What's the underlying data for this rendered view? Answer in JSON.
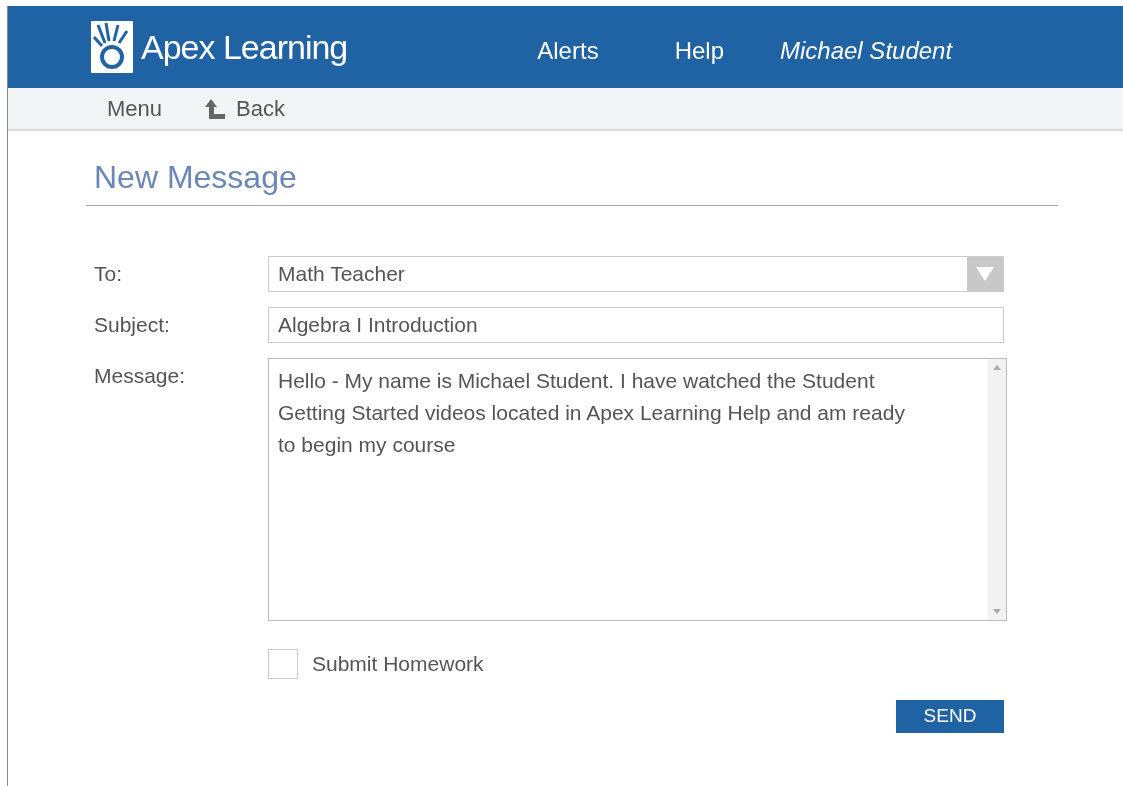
{
  "header": {
    "brand": "Apex Learning",
    "nav": [
      "Alerts",
      "Help"
    ],
    "user": "Michael Student"
  },
  "toolbar": {
    "menu": "Menu",
    "back": "Back"
  },
  "page_title": "New Message",
  "form": {
    "to": {
      "label": "To:",
      "value": "Math Teacher"
    },
    "subject": {
      "label": "Subject:",
      "value": "Algebra I Introduction"
    },
    "message": {
      "label": "Message:",
      "value": "Hello - My name is Michael Student. I have watched the Student Getting Started videos located in Apex Learning Help and am ready to begin my course"
    },
    "submit_homework": {
      "label": "Submit Homework",
      "checked": false
    },
    "send": "SEND"
  }
}
